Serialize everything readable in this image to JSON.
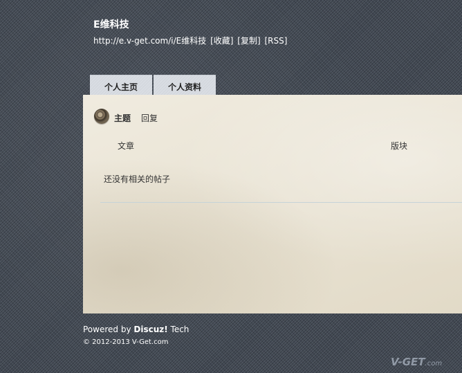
{
  "site": {
    "title": "E维科技",
    "url": "http://e.v-get.com/i/E维科技",
    "favorite": "[收藏]",
    "copy": "[复制]",
    "rss": "[RSS]"
  },
  "tabs": [
    {
      "label": "个人主页"
    },
    {
      "label": "个人资料"
    }
  ],
  "panel": {
    "tab_topic": "主题",
    "tab_reply": "回复",
    "col_article": "文章",
    "col_board": "版块",
    "empty_message": "还没有相关的帖子"
  },
  "footer": {
    "powered_prefix": "Powered by ",
    "powered_brand": "Discuz!",
    "powered_suffix": " Tech",
    "copyright": "© 2012-2013 V-Get.com"
  },
  "watermark": {
    "brand": "V-GET",
    "suffix": ".com"
  }
}
